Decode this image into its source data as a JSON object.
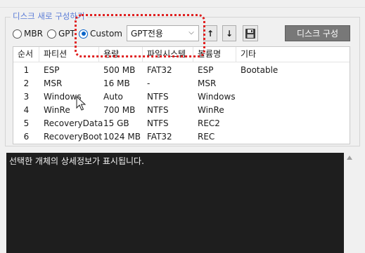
{
  "group_title": "디스크 새로 구성하기",
  "options": {
    "mbr_label": "MBR",
    "gpt_label": "GPT",
    "custom_label": "Custom",
    "selected": "Custom"
  },
  "layout_select": {
    "value": "GPT전용"
  },
  "buttons": {
    "up_symbol": "↑",
    "down_symbol": "↓",
    "build_label": "디스크 구성"
  },
  "table": {
    "columns": [
      "순서",
      "파티션",
      "용량",
      "파일시스템",
      "볼륨명",
      "기타"
    ],
    "rows": [
      [
        "1",
        "ESP",
        "500 MB",
        "FAT32",
        "ESP",
        "Bootable"
      ],
      [
        "2",
        "MSR",
        "16 MB",
        "-",
        "MSR",
        ""
      ],
      [
        "3",
        "Windows",
        "Auto",
        "NTFS",
        "Windows",
        ""
      ],
      [
        "4",
        "WinRe",
        "700 MB",
        "NTFS",
        "WinRe",
        ""
      ],
      [
        "5",
        "RecoveryData",
        "15 GB",
        "NTFS",
        "REC2",
        ""
      ],
      [
        "6",
        "RecoveryBoot",
        "1024 MB",
        "FAT32",
        "REC",
        ""
      ]
    ]
  },
  "detail_text": "선택한 개체의 상세정보가 표시됩니다.",
  "colors": {
    "group_title": "#5a7bd6",
    "highlight": "#e02020",
    "radio_selected": "#0a64c8",
    "build_button": "#787878",
    "detail_bg": "#1e1e1e"
  }
}
